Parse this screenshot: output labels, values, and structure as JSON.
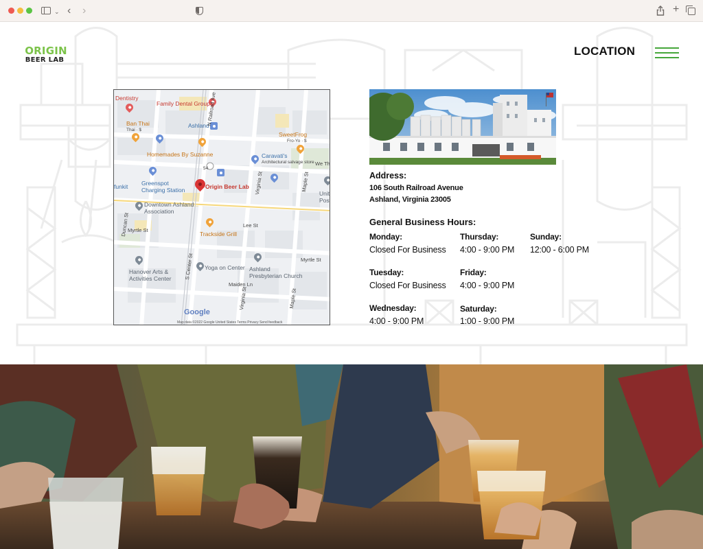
{
  "brand": {
    "name_top": "ORIGIN",
    "name_bottom": "BEER LAB"
  },
  "nav": {
    "page_title": "LOCATION"
  },
  "map": {
    "labels": {
      "dentistry": "Dentistry",
      "family_dental": "Family Dental Group",
      "ban_thai": "Ban Thai",
      "ban_thai_sub": "Thai · $",
      "ashland": "Ashland",
      "sweetfrog": "SweetFrog",
      "sweetfrog_sub": "Fro-Yo · $",
      "homemades": "Homemades By Suzanne",
      "caravatis": "Caravati's",
      "caravatis_sub": "Architectural salvage store",
      "greenspot": "Greenspot",
      "greenspot_sub": "Charging Station",
      "origin": "Origin Beer Lab",
      "funkit": "funkit",
      "downtown": "Downtown Ashland",
      "downtown_sub": "Association",
      "trackside": "Trackside Grill",
      "lee_st": "Lee St",
      "myrtle_st_w": "Myrtle St",
      "myrtle_st_e": "Myrtle St",
      "hanover": "Hanover Arts &",
      "hanover_sub": "Activities Center",
      "yoga": "Yoga on Center",
      "presbyterian": "Ashland",
      "presbyterian_sub": "Presbyterian Church",
      "maiden_ln": "Maiden Ln",
      "railroad_ave": "N Railroad Ave",
      "virginia_st": "Virginia St",
      "virginia_st_s": "Virginia St",
      "maple_st": "Maple St",
      "maple_st_s": "Maple St",
      "center_st": "S Center St",
      "duncan_st": "Duncan St",
      "we_th": "We Th",
      "unit_post": "Unit",
      "unit_post_sub": "Post",
      "route_54": "54"
    },
    "google": "Google",
    "footer": "Map data ©2022 Google    United States    Terms    Privacy    Send feedback"
  },
  "address": {
    "title": "Address:",
    "line1": "106 South Railroad Avenue",
    "line2": "Ashland, Virginia 23005"
  },
  "hours": {
    "title": "General Business Hours:",
    "days": [
      {
        "day": "Monday:",
        "time": "Closed For Business"
      },
      {
        "day": "Tuesday:",
        "time": "Closed For Business"
      },
      {
        "day": "Wednesday:",
        "time": "4:00 - 9:00 PM"
      },
      {
        "day": "Thursday:",
        "time": "4:00 - 9:00 PM"
      },
      {
        "day": "Friday:",
        "time": "4:00 - 9:00 PM"
      },
      {
        "day": "Saturday:",
        "time": "1:00 - 9:00 PM"
      },
      {
        "day": "Sunday:",
        "time": "12:00 - 6:00 PM"
      }
    ]
  },
  "colors": {
    "brand_green": "#7cc34a",
    "menu_green": "#45a63a",
    "pin_red": "#d93535"
  }
}
